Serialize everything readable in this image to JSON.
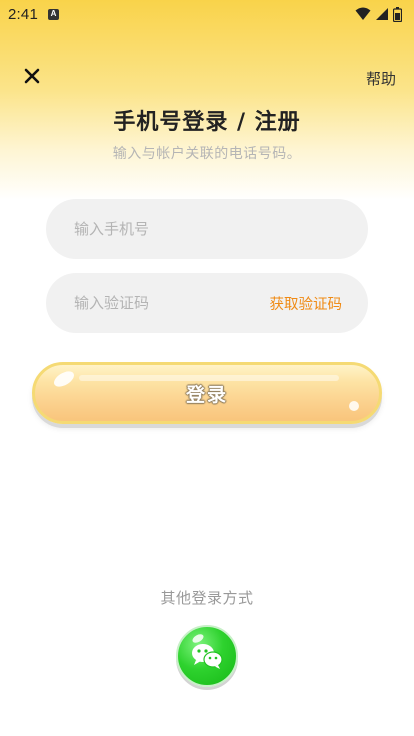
{
  "status_bar": {
    "time": "2:41",
    "badge_letter": "A",
    "icons": [
      "wifi-icon",
      "signal-icon",
      "battery-icon"
    ]
  },
  "header": {
    "close_icon": "close-icon",
    "help_label": "帮助"
  },
  "title": "手机号登录 / 注册",
  "subtitle": "输入与帐户关联的电话号码。",
  "phone_input": {
    "placeholder": "输入手机号",
    "value": ""
  },
  "code_input": {
    "placeholder": "输入验证码",
    "value": "",
    "get_code_label": "获取验证码"
  },
  "login_button": {
    "label": "登录"
  },
  "other_login": {
    "label": "其他登录方式",
    "methods": [
      {
        "name": "wechat",
        "icon": "wechat-icon"
      }
    ]
  },
  "colors": {
    "accent_orange": "#f08a14",
    "top_yellow": "#f9d34a",
    "wechat_green": "#2ed22e"
  }
}
